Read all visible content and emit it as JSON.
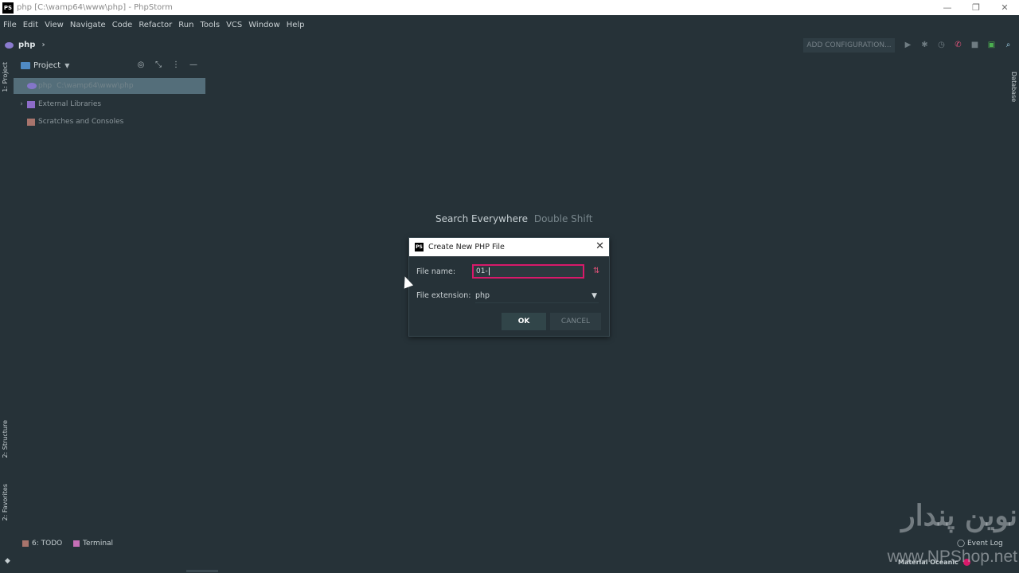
{
  "window": {
    "title": "php [C:\\wamp64\\www\\php] - PhpStorm",
    "logo_text": "PS"
  },
  "window_controls": {
    "minimize": "—",
    "restore": "❐",
    "close": "✕"
  },
  "menu": [
    "File",
    "Edit",
    "View",
    "Navigate",
    "Code",
    "Refactor",
    "Run",
    "Tools",
    "VCS",
    "Window",
    "Help"
  ],
  "navbar": {
    "project": "php",
    "chevron": "›"
  },
  "toolbar": {
    "add_config": "ADD CONFIGURATION...",
    "icons": [
      "run-icon",
      "debug-icon",
      "coverage-icon",
      "phone-listen-icon",
      "stop-icon",
      "terminal-icon",
      "search-icon"
    ]
  },
  "left_tabs": {
    "project": "1: Project",
    "structure": "2: Structure",
    "favorites": "2: Favorites"
  },
  "right_tabs": {
    "database": "Database"
  },
  "project_panel": {
    "header": "Project",
    "tree": [
      {
        "name": "php",
        "path": "C:\\wamp64\\www\\php"
      },
      {
        "name": "External Libraries"
      },
      {
        "name": "Scratches and Consoles"
      }
    ]
  },
  "search_hint": {
    "label": "Search Everywhere",
    "shortcut": "Double Shift"
  },
  "dialog": {
    "title": "Create New PHP File",
    "file_name_label": "File name:",
    "file_name_value": "01-",
    "file_ext_label": "File extension:",
    "file_ext_value": "php",
    "ok": "OK",
    "cancel": "CANCEL"
  },
  "bottom": {
    "todo": "6: TODO",
    "terminal": "Terminal",
    "event_log": "Event Log",
    "theme": "Material Oceanic"
  },
  "watermark": {
    "logo": "نوین پندار",
    "url": "www.NPShop.net"
  },
  "colors": {
    "background": "#263238",
    "accent": "#d8196a",
    "selection": "#546e7a"
  }
}
